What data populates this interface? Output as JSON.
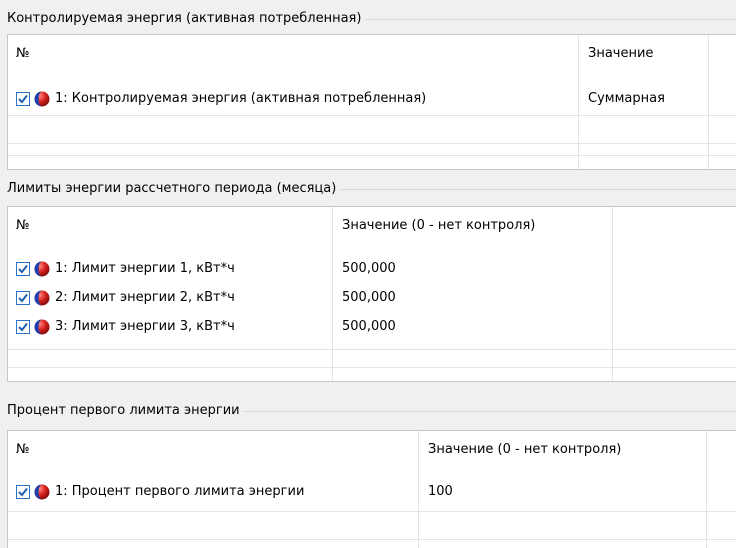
{
  "sections": [
    {
      "title": "Контролируемая энергия (активная потребленная)",
      "columns": [
        "№",
        "Значение"
      ],
      "rows": [
        {
          "name": "1: Контролируемая энергия (активная потребленная)",
          "value": "Суммарная",
          "checked": true
        }
      ]
    },
    {
      "title": "Лимиты энергии рассчетного периода (месяца)",
      "columns": [
        "№",
        "Значение (0 - нет контроля)"
      ],
      "rows": [
        {
          "name": "1: Лимит энергии 1, кВт*ч",
          "value": "500,000",
          "checked": true
        },
        {
          "name": "2: Лимит энергии 2, кВт*ч",
          "value": "500,000",
          "checked": true
        },
        {
          "name": "3: Лимит энергии 3, кВт*ч",
          "value": "500,000",
          "checked": true
        }
      ]
    },
    {
      "title": "Процент первого лимита энергии",
      "columns": [
        "№",
        "Значение (0 - нет контроля)"
      ],
      "rows": [
        {
          "name": "1: Процент первого лимита энергии",
          "value": "100",
          "checked": true
        }
      ]
    }
  ],
  "icons": {
    "checkbox": "checkbox-checked-icon",
    "row_marker": "blue-red-sphere-icon"
  },
  "colors": {
    "checkbox_border": "#2a73c8",
    "checkmark": "#1f5fb4",
    "sphere_red": "#d8231f",
    "sphere_blue": "#1f3fb0",
    "grid_line": "#e3e3e3",
    "background": "#f0f0f0"
  }
}
